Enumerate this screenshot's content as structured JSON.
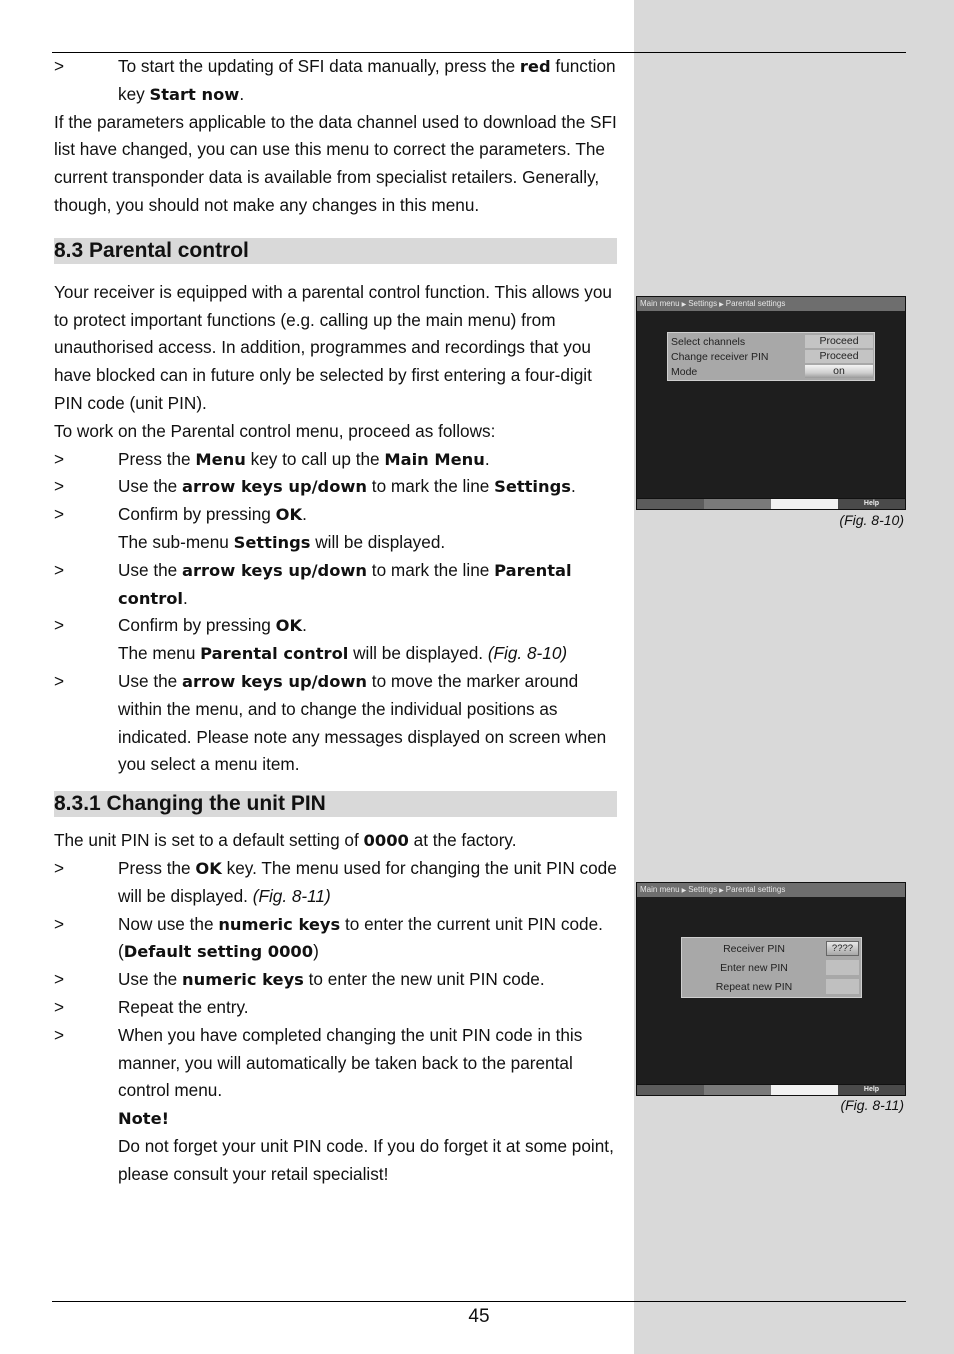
{
  "page_number": "45",
  "intro": {
    "step1": {
      "marker": ">",
      "t1": "To start the updating of SFI data manually, press the ",
      "b1": "red",
      "t2": " function key ",
      "b2": "Start now",
      "t3": "."
    },
    "para": "If the parameters applicable to the data channel used to download the SFI list have changed, you can use this menu to correct the parameters. The current transponder data is available from specialist retailers. Generally, though, you should not make any changes in this menu."
  },
  "section_8_3": {
    "heading": "8.3 Parental control",
    "para1": "Your receiver is equipped with a parental control function. This allows you to protect important functions (e.g. calling up the main menu) from unauthorised access. In addition, programmes and recordings that you have blocked can in future only be selected by first entering a four-digit PIN code (unit PIN).",
    "para2": "To work on the Parental control menu, proceed as follows:",
    "steps": {
      "s1": {
        "marker": ">",
        "t1": "Press the ",
        "b1": "Menu",
        "t2": " key to call up the ",
        "b2": "Main Menu",
        "t3": "."
      },
      "s2": {
        "marker": ">",
        "t1": "Use the ",
        "b1": "arrow keys up/down",
        "t2": " to mark the line ",
        "b2": "Settings",
        "t3": "."
      },
      "s3": {
        "marker": ">",
        "t1": "Confirm by pressing ",
        "b1": "OK",
        "t2": "."
      },
      "s3_note": {
        "t1": "The sub-menu ",
        "b1": "Settings",
        "t2": " will be displayed."
      },
      "s4": {
        "marker": ">",
        "t1": "Use the ",
        "b1": "arrow keys up/down",
        "t2": " to mark the line ",
        "b2": "Parental control",
        "t3": "."
      },
      "s5": {
        "marker": ">",
        "t1": "Confirm by pressing ",
        "b1": "OK",
        "t2": "."
      },
      "s5_note": {
        "t1": "The menu ",
        "b1": "Parental control",
        "t2": " will be displayed. ",
        "i1": "(Fig. 8-10)"
      },
      "s6": {
        "marker": ">",
        "t1": "Use the ",
        "b1": "arrow keys up/down",
        "t2": " to move the marker around within the menu, and to change the individual positions as indicated. Please note any messages displayed on screen when you select a menu item."
      }
    }
  },
  "section_8_3_1": {
    "heading": "8.3.1 Changing the unit PIN",
    "para1": {
      "t1": "The unit PIN is set to a default setting of ",
      "b1": "0000",
      "t2": " at the factory."
    },
    "steps": {
      "s1": {
        "marker": ">",
        "t1": "Press the ",
        "b1": "OK",
        "t2": " key. The menu used for changing the unit PIN code will be displayed. ",
        "i1": "(Fig. 8-11)"
      },
      "s2": {
        "marker": ">",
        "t1": "Now use the ",
        "b1": "numeric keys",
        "t2": " to enter the current unit PIN code."
      },
      "s2_note": {
        "t1": "(",
        "b1": "Default setting 0000",
        "t2": ")"
      },
      "s3": {
        "marker": ">",
        "t1": "Use the ",
        "b1": "numeric keys",
        "t2": " to enter the new unit PIN code."
      },
      "s4": {
        "marker": ">",
        "t1": "Repeat the entry."
      },
      "s5": {
        "marker": ">",
        "t1": "When you have completed changing the unit PIN code in this manner, you will automatically be taken back to the parental control menu."
      },
      "note_title": "Note!",
      "note_text": "Do not forget your unit PIN code. If you do forget it at some point, please consult your retail specialist!"
    }
  },
  "figures": {
    "fig_8_10": {
      "caption": "(Fig. 8-10)",
      "breadcrumb": [
        "Main menu",
        "Settings",
        "Parental settings"
      ],
      "rows": [
        {
          "label": "Select channels",
          "value": "Proceed"
        },
        {
          "label": "Change receiver PIN",
          "value": "Proceed"
        },
        {
          "label": "Mode",
          "value": "on"
        }
      ],
      "bar_help": "Help"
    },
    "fig_8_11": {
      "caption": "(Fig. 8-11)",
      "breadcrumb": [
        "Main menu",
        "Settings",
        "Parental settings"
      ],
      "rows": [
        {
          "label": "Receiver PIN",
          "value": "????"
        },
        {
          "label": "Enter new PIN",
          "value": ""
        },
        {
          "label": "Repeat new PIN",
          "value": ""
        }
      ],
      "bar_help": "Help"
    }
  }
}
